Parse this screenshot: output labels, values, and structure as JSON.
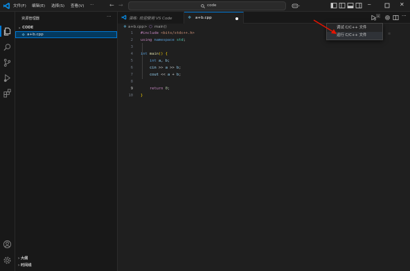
{
  "menu": {
    "file": "文件(F)",
    "edit": "编辑(E)",
    "selection": "选择(S)",
    "view": "查看(V)",
    "more": "···"
  },
  "command_center": {
    "text": "code"
  },
  "sidebar": {
    "title": "资源管理器",
    "more": "···",
    "folder": "CODE",
    "file": "a+b.cpp",
    "outline": "大纲",
    "timeline": "时间线"
  },
  "tabs": [
    {
      "label": "演练: 欢迎使用 VS Code"
    },
    {
      "label": "a+b.cpp"
    }
  ],
  "breadcrumb": {
    "file": "a+b.cpp",
    "sep": ">",
    "symbol": "main()"
  },
  "editor": {
    "line_numbers": [
      "1",
      "2",
      "3",
      "4",
      "5",
      "6",
      "7",
      "8",
      "9",
      "10"
    ],
    "current_line": 9,
    "code": {
      "l1_kw": "#include",
      "l1_str": "<bits/stdc++.h>",
      "l2_kw": "using",
      "l2_kw2": "namespace",
      "l2_ns": "std",
      "l2_end": ";",
      "l4_kw": "int",
      "l4_fn": "main",
      "l4_paren": "()",
      "l4_brace": "{",
      "l5_kw": "int",
      "l5_rest": "a, b;",
      "l6_var": "cin",
      "l6_op": ">>",
      "l6_a": "a",
      "l6_b": "b",
      "l6_end": ";",
      "l7_var": "cout",
      "l7_op": "<<",
      "l7_a": "a",
      "l7_plus": "+",
      "l7_b": "b",
      "l7_end": ";",
      "l9_kw": "return",
      "l9_num": "0",
      "l9_end": ";",
      "l10_brace": "}"
    }
  },
  "run_menu": {
    "items": [
      "调试 C/C++ 文件",
      "运行 C/C++ 文件"
    ],
    "hovered_index": 1
  },
  "colors": {
    "accent": "#0078d4",
    "arrow": "#e51400"
  }
}
